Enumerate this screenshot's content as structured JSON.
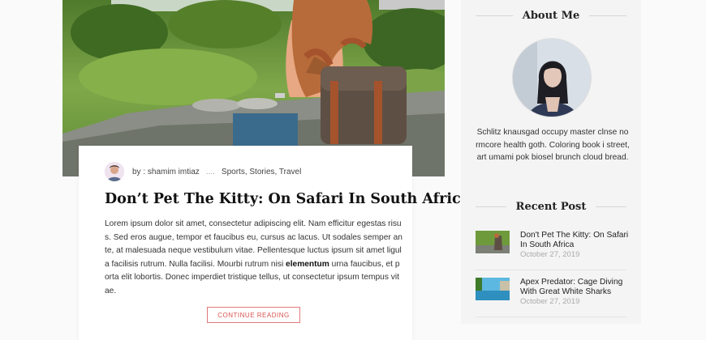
{
  "post": {
    "meta": {
      "author": "by : shamim imtiaz",
      "separator": "....",
      "categories": "Sports, Stories, Travel"
    },
    "title": "Don’t Pet The Kitty: On Safari In South Africa",
    "excerpt": {
      "before": "Lorem ipsum dolor sit amet, consectetur adipiscing elit. Nam efficitur egestas risus. Sed eros augue, tempor et faucibus eu, cursus ac lacus. Ut sodales semper ante, at malesuada neque vestibulum vitae. Pellentesque luctus ipsum sit amet ligula facilisis rutrum. Nulla facilisi. Mourbi rutrum nisi ",
      "bold": "elementum",
      "after": " urna faucibus, et porta elit lobortis. Donec imperdiet tristique tellus, ut consectetur ipsum tempus vitae."
    },
    "read_more": "CONTINUE READING"
  },
  "sidebar": {
    "about": {
      "title": "About Me",
      "text": "Schlitz knausgad occupy master clnse normcore health goth. Coloring book i street, art umami pok biosel brunch cloud bread."
    },
    "recent": {
      "title": "Recent Post",
      "items": [
        {
          "title": "Don't Pet The Kitty: On Safari In South Africa",
          "date": "October 27, 2019"
        },
        {
          "title": "Apex Predator: Cage Diving With Great White Sharks",
          "date": "October 27, 2019"
        }
      ]
    }
  }
}
